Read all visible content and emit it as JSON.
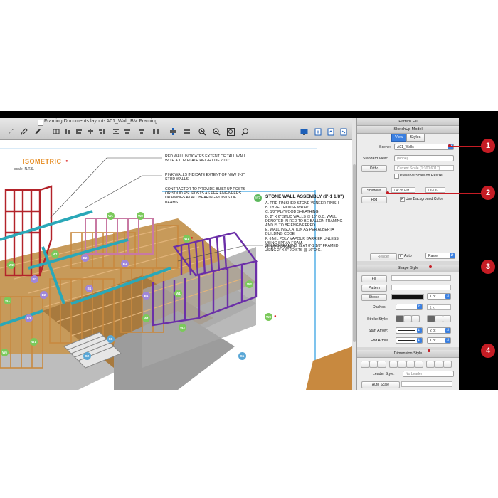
{
  "window": {
    "title": "Framing Documents.layout- A01_Wall_BM Framing"
  },
  "toolbar": {
    "icons": [
      "select-icon",
      "pen-icon",
      "pencil-icon",
      "eraser-icon",
      "style-icon",
      "align-left-icon",
      "align-center-icon",
      "align-right-icon",
      "distribute-icon",
      "arrange-icon",
      "group-icon",
      "ungroup-icon",
      "zoom-in-icon",
      "zoom-out-icon",
      "zoom-fit-icon",
      "zoom-tool-icon",
      "presentation-icon",
      "add-page-icon",
      "export-icon",
      "share-icon"
    ]
  },
  "drawing": {
    "iso_title": "ISOMETRIC",
    "scale_label": "scale: N.T.S.",
    "note_red_wall": "RED WALL INDICATES EXTENT OF TALL WALL WITH A TOP PLATE HEIGHT OF 20'-0\"",
    "note_pink_wall": "PINK WALLS INDICATE EXTENT OF NEW 9'-2\" STUD WALLS",
    "note_contractor": "CONTRACTOR TO PROVIDE BUILT UP POSTS OR SOLID PSL POSTS AS PER ENGINEERS DRAWINGS AT ALL BEARING POINTS OF BEAMS.",
    "stone_badge": "W3",
    "stone_title": "STONE WALL ASSEMBLY (9'-1 1/8\")",
    "stone_items": [
      "A. PRE-FINISHED STONE VENEER FINISH",
      "B. TYVEC HOUSE WRAP",
      "C. 1/2\" PLYWOOD SHEATHING",
      "D. 2\" X 6\" STUD WALLS @ 16\" O.C. WALL DENOTED IN RED TO BE BALLON FRAMING AND IS TO BE ENGINEERED",
      "E. WALL INSULATION AS PER ALBERTA BUILDING CODE",
      "F. 6 MIL POLY VAPOUR BARRIER UNLESS USING SPRAY FOAM.",
      "G. 1/2\" DRYWALL"
    ],
    "ceiling_note": "CEILING FRAMING IS AT 8'-1 1/8\" FRAMED USING 2\" X 6\" JOISTS @ 16\"O.C.",
    "badges": {
      "b1": "B1",
      "b2": "B2",
      "b3": "B3",
      "w1": "W1",
      "w2": "W2",
      "w3": "W3",
      "s1": "S1",
      "s2": "S2",
      "w6": "W6"
    }
  },
  "panel": {
    "pattern_fill": "Pattern Fill",
    "sketchup_model": "SketchUp Model",
    "tab_view": "View",
    "tab_styles": "Styles",
    "scene_label": "Scene:",
    "scene_value": "A01_Walls",
    "standard_view_label": "Standard View:",
    "standard_view_value": "(None)",
    "ortho_label": "Ortho",
    "current_scale": "Current Scale (1:300.6017)",
    "preserve_scale": "Preserve Scale on Resize",
    "shadows_label": "Shadows",
    "shadow_time": "04:38 PM",
    "shadow_date": "06/06",
    "fog_label": "Fog",
    "use_bg_color": "Use Background Color",
    "render_label": "Render",
    "auto_label": "Auto",
    "raster_label": "Raster",
    "shape_style": "Shape Style",
    "fill_label": "Fill",
    "pattern_label": "Pattern",
    "stroke_label": "Stroke",
    "stroke_width": "1 pt",
    "dashes_label": "Dashes:",
    "dashes_scale": "1 x",
    "stroke_style_label": "Stroke Style:",
    "start_arrow_label": "Start Arrow:",
    "start_arrow_size": "2 pt",
    "end_arrow_label": "End Arrow:",
    "end_arrow_size": "1 pt",
    "dimension_style": "Dimension Style",
    "leader_style_label": "Leader Style:",
    "leader_style_value": "No Leader",
    "auto_scale": "Auto Scale"
  },
  "callouts": [
    "1",
    "2",
    "3",
    "4"
  ],
  "colors": {
    "callout_red": "#c61c24",
    "select_blue": "#3a7fe0",
    "iso_orange": "#e7902a",
    "framing_red": "#b3232a",
    "framing_purple": "#6b2fa8",
    "beam_cyan": "#2aa8b8"
  }
}
